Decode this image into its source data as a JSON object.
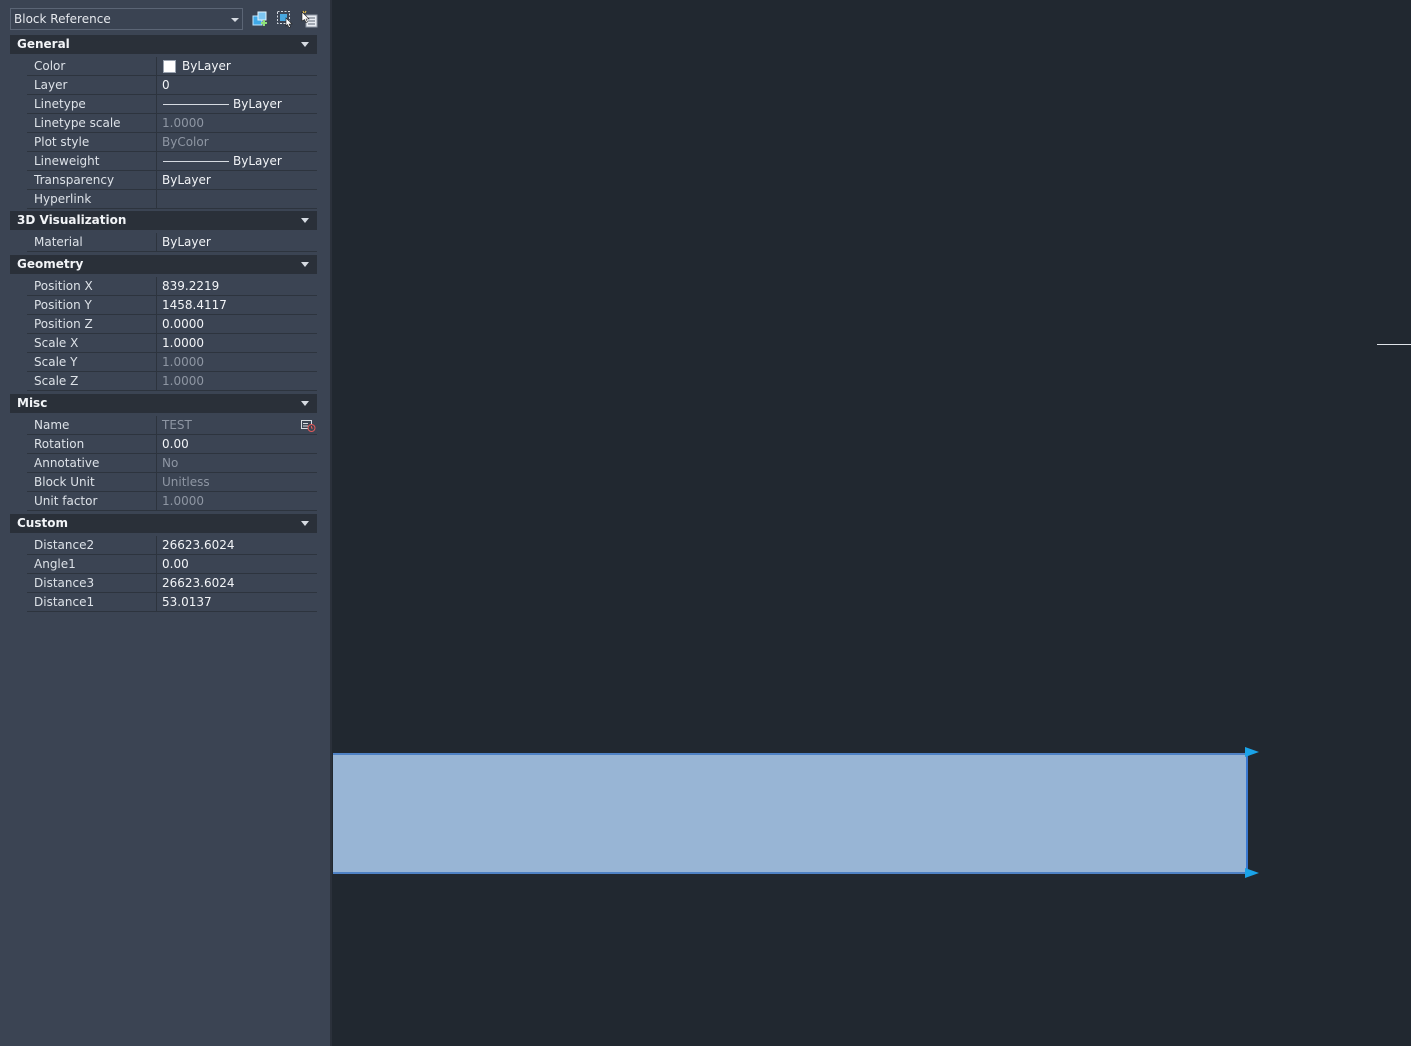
{
  "palette": {
    "type_selector": "Block Reference",
    "toolbar_icons": [
      "toggle-pickadd-icon",
      "select-objects-icon",
      "quick-select-icon"
    ]
  },
  "categories": [
    {
      "title": "General",
      "rows": [
        {
          "label": "Color",
          "value": "ByLayer",
          "kind": "color",
          "swatch": "#ffffff"
        },
        {
          "label": "Layer",
          "value": "0"
        },
        {
          "label": "Linetype",
          "value": "ByLayer",
          "kind": "line"
        },
        {
          "label": "Linetype scale",
          "value": "1.0000",
          "readonly": true
        },
        {
          "label": "Plot style",
          "value": "ByColor",
          "readonly": true
        },
        {
          "label": "Lineweight",
          "value": "ByLayer",
          "kind": "line"
        },
        {
          "label": "Transparency",
          "value": "ByLayer"
        },
        {
          "label": "Hyperlink",
          "value": ""
        }
      ]
    },
    {
      "title": "3D Visualization",
      "rows": [
        {
          "label": "Material",
          "value": "ByLayer"
        }
      ]
    },
    {
      "title": "Geometry",
      "rows": [
        {
          "label": "Position X",
          "value": "839.2219"
        },
        {
          "label": "Position Y",
          "value": "1458.4117"
        },
        {
          "label": "Position Z",
          "value": "0.0000"
        },
        {
          "label": "Scale X",
          "value": "1.0000"
        },
        {
          "label": "Scale Y",
          "value": "1.0000",
          "readonly": true
        },
        {
          "label": "Scale Z",
          "value": "1.0000",
          "readonly": true
        }
      ]
    },
    {
      "title": "Misc",
      "rows": [
        {
          "label": "Name",
          "value": "TEST",
          "readonly": true,
          "icon": "block-editor-icon"
        },
        {
          "label": "Rotation",
          "value": "0.00"
        },
        {
          "label": "Annotative",
          "value": "No",
          "readonly": true
        },
        {
          "label": "Block Unit",
          "value": "Unitless",
          "readonly": true
        },
        {
          "label": "Unit factor",
          "value": "1.0000",
          "readonly": true
        }
      ]
    },
    {
      "title": "Custom",
      "rows": [
        {
          "label": "Distance2",
          "value": "26623.6024"
        },
        {
          "label": "Angle1",
          "value": "0.00"
        },
        {
          "label": "Distance3",
          "value": "26623.6024"
        },
        {
          "label": "Distance1",
          "value": "53.0137"
        }
      ]
    }
  ],
  "colors": {
    "palette_bg": "#3b4453",
    "canvas_bg": "#212830",
    "selection_fill": "#98b5d5",
    "grip": "#1aa3e8"
  }
}
